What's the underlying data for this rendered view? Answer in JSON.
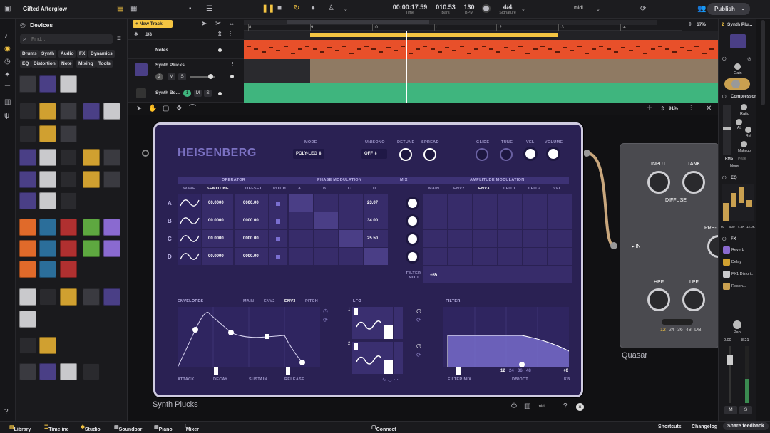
{
  "project": {
    "name": "Gifted Afterglow"
  },
  "transport": {
    "time": "00:00:17.59",
    "time_label": "Time",
    "bars": "010.53",
    "bars_label": "Bars",
    "bpm": "130",
    "bpm_label": "BPM",
    "signature": "4/4",
    "signature_label": "Signature",
    "midi": "midi",
    "publish": "Publish"
  },
  "devices": {
    "title": "Devices",
    "search_placeholder": "Find...",
    "chips": [
      "Drums",
      "Synth",
      "Audio",
      "FX",
      "Dynamics",
      "EQ",
      "Distortion",
      "Note",
      "Mixing",
      "Tools"
    ]
  },
  "tracks": {
    "new_track": "New Track",
    "quantize": "1/8",
    "list": [
      {
        "name": "Notes"
      },
      {
        "name": "Synth Plucks",
        "num": "2"
      },
      {
        "name": "Synth Bo...",
        "num": "1"
      }
    ],
    "mute": "M",
    "solo": "S",
    "ruler": [
      "8",
      "9",
      "10",
      "11",
      "12",
      "13",
      "14",
      "15"
    ],
    "zoom": "67%"
  },
  "studio": {
    "zoom": "91%"
  },
  "heisenberg": {
    "name": "HEISENBERG",
    "mode_label": "MODE",
    "mode_value": "POLY-LEG",
    "unison_label": "UNISONO",
    "unison_value": "OFF",
    "detune": "DETUNE",
    "spread": "SPREAD",
    "glide": "GLIDE",
    "tune": "TUNE",
    "vel": "VEL",
    "volume": "VOLUME",
    "sections": {
      "operator": "OPERATOR",
      "phase_mod": "PHASE MODULATION",
      "mix": "MIX",
      "amp_mod": "AMPLITUDE MODULATION"
    },
    "op_cols": [
      "WAVE",
      "SEMITONE",
      "OFFSET",
      "PITCH"
    ],
    "pm_cols": [
      "A",
      "B",
      "C",
      "D"
    ],
    "am_cols": [
      "MAIN",
      "ENV2",
      "ENV3",
      "LFO 1",
      "LFO 2",
      "VEL"
    ],
    "rows": [
      {
        "op": "A",
        "semitone": "00.0000",
        "offset": "0000.00",
        "pm": "23.07"
      },
      {
        "op": "B",
        "semitone": "00.0000",
        "offset": "0000.00",
        "pm": "34.00"
      },
      {
        "op": "C",
        "semitone": "00.0000",
        "offset": "0000.00",
        "pm": "25.50"
      },
      {
        "op": "D",
        "semitone": "00.0000",
        "offset": "0000.00",
        "pm": ""
      }
    ],
    "filter_mod": "FILTER MOD",
    "filter_mod_value": "+65",
    "envelopes": "ENVELOPES",
    "env_tabs": [
      "MAIN",
      "ENV2",
      "ENV3",
      "PITCH"
    ],
    "env_params": [
      "ATTACK",
      "DECAY",
      "SUSTAIN",
      "RELEASE"
    ],
    "lfo": "LFO",
    "lfo_nums": [
      "1",
      "2"
    ],
    "filter": "FILTER",
    "filter_slopes": [
      "12",
      "24",
      "36",
      "48"
    ],
    "filter_mix": "FILTER MIX",
    "db_oct": "DB/OCT",
    "kb": "KB",
    "kb_value": "+0",
    "device_name": "Synth Plucks"
  },
  "quasar": {
    "name": "Quasar",
    "input": "INPUT",
    "tank": "TANK",
    "diffuse": "DIFFUSE",
    "pre": "PRE-",
    "in": "IN",
    "hpf": "HPF",
    "lpf": "LPF",
    "db": [
      "12",
      "24",
      "36",
      "48",
      "DB"
    ]
  },
  "inspector": {
    "track": "Synth Plu...",
    "track_num": "2",
    "gain": "Gain",
    "compressor": "Compressor",
    "ratio": "Ratio",
    "att": "Att",
    "rel": "Rel",
    "makeup": "Makeup",
    "rms": "RMS",
    "peak": "Peak",
    "none": "None",
    "eq": "EQ",
    "eq_vals": [
      "60",
      "500",
      "4.8K",
      "12.0K"
    ],
    "fx": "FX",
    "fx_items": [
      "Reverb",
      "Delay",
      "FX1 Distort...",
      "Reson..."
    ],
    "pan": "Pan",
    "db_l": "0.00",
    "db_r": "-8.21",
    "mute": "M",
    "solo": "S"
  },
  "bottom": {
    "library": "Library",
    "timeline": "Timeline",
    "studio": "Studio",
    "soundbar": "Soundbar",
    "piano": "Piano",
    "mixer": "Mixer",
    "connect": "Connect",
    "shortcuts": "Shortcuts",
    "changelog": "Changelog",
    "feedback": "Share feedback"
  },
  "colors": {
    "accent": "#f5c542",
    "notes_lane": "#e8502a",
    "plucks_lane": "#8f7a63",
    "bass_lane": "#3fb57e",
    "plugin": "#2a2153"
  }
}
